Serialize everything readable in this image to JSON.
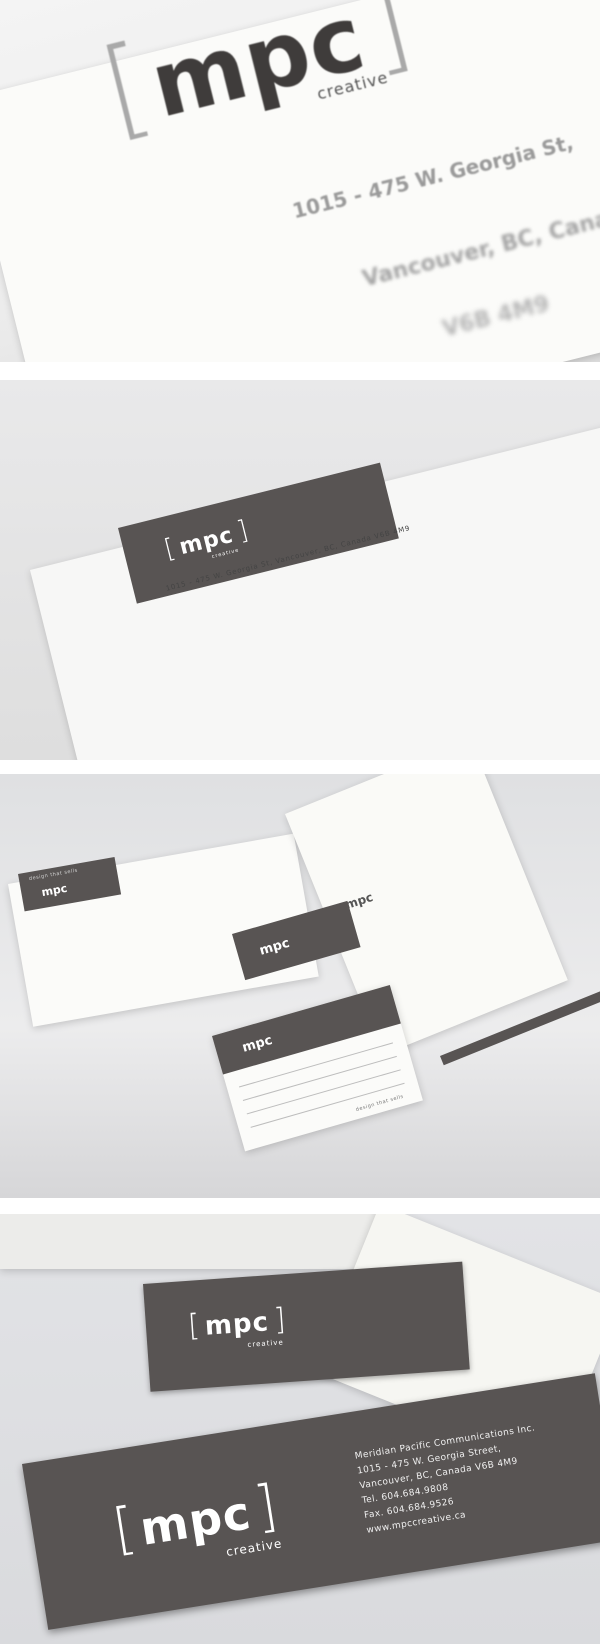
{
  "photo1": {
    "logo_bracket_left": "[",
    "logo_word": "mpc",
    "logo_sub": "creative",
    "logo_bracket_right": "]",
    "address_line1": "1015 - 475 W. Georgia St,",
    "address_line2": "Vancouver, BC, Canada",
    "address_line3": "V6B 4M9"
  },
  "photo2": {
    "logo_bracket_left": "[",
    "logo_word": "mpc",
    "logo_sub": "creative",
    "logo_bracket_right": "]",
    "address": "1015 - 475 W. Georgia St, Vancouver, BC, Canada  V6B 4M9"
  },
  "photo3": {
    "logo_word": "mpc",
    "logo_sub": "creative",
    "tagline": "design that sells"
  },
  "photo4": {
    "logo_bracket_left": "[",
    "logo_word": "mpc",
    "logo_sub": "creative",
    "logo_bracket_right": "]",
    "company": "Meridian Pacific Communications Inc.",
    "street": "1015 - 475 W. Georgia Street,",
    "city": "Vancouver, BC, Canada  V6B 4M9",
    "tel": "Tel.   604.684.9808",
    "fax": "Fax.  604.684.9526",
    "web": "www.mpccreative.ca"
  },
  "colors": {
    "card": "#585453",
    "paper": "#fbfbf9",
    "logo_grey": "#3f3c3b"
  }
}
